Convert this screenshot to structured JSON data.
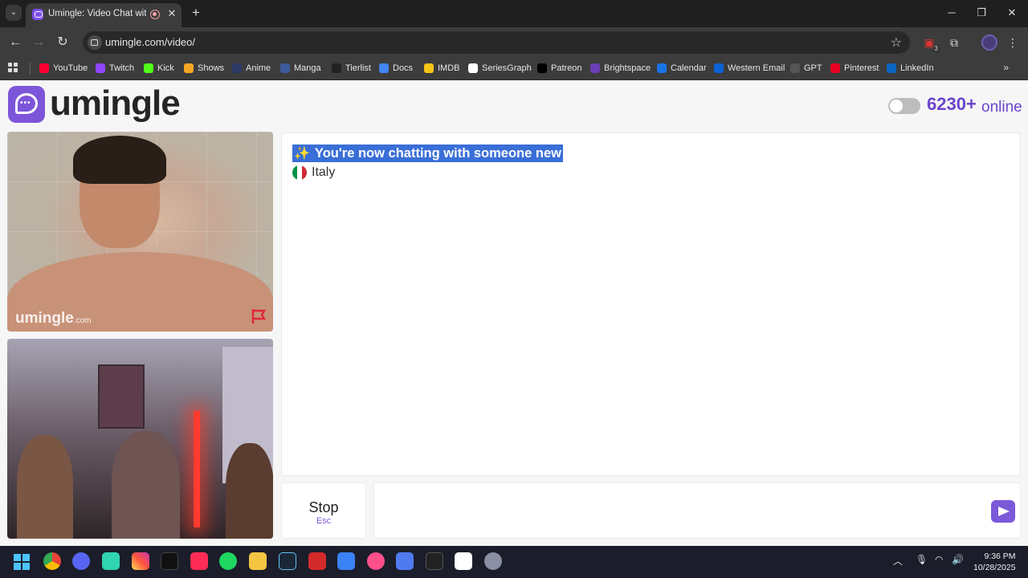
{
  "browser": {
    "tab_title": "Umingle: Video Chat with St",
    "url": "umingle.com/video/",
    "extension_badge": "3"
  },
  "bookmarks": [
    {
      "label": "YouTube",
      "icon": "youtube-icon",
      "color": "#ff0033"
    },
    {
      "label": "Twitch",
      "icon": "twitch-icon",
      "color": "#9146ff"
    },
    {
      "label": "Kick",
      "icon": "kick-icon",
      "color": "#53fc18"
    },
    {
      "label": "Shows",
      "icon": "shows-icon",
      "color": "#f5a623"
    },
    {
      "label": "Anime",
      "icon": "anime-icon",
      "color": "#2b3a67"
    },
    {
      "label": "Manga",
      "icon": "manga-icon",
      "color": "#3d5a99"
    },
    {
      "label": "Tierlist",
      "icon": "tierlist-icon",
      "color": "#222222"
    },
    {
      "label": "Docs",
      "icon": "docs-icon",
      "color": "#4285f4"
    },
    {
      "label": "IMDB",
      "icon": "imdb-icon",
      "color": "#f5c518"
    },
    {
      "label": "SeriesGraph",
      "icon": "seriesgraph-icon",
      "color": "#ffffff"
    },
    {
      "label": "Patreon",
      "icon": "patreon-icon",
      "color": "#000000"
    },
    {
      "label": "Brightspace",
      "icon": "brightspace-icon",
      "color": "#6a3fb5"
    },
    {
      "label": "Calendar",
      "icon": "calendar-icon",
      "color": "#1a73e8"
    },
    {
      "label": "Western Email",
      "icon": "outlook-icon",
      "color": "#0a64d6"
    },
    {
      "label": "GPT",
      "icon": "gpt-icon",
      "color": "#555555"
    },
    {
      "label": "Pinterest",
      "icon": "pinterest-icon",
      "color": "#e60023"
    },
    {
      "label": "LinkedIn",
      "icon": "linkedin-icon",
      "color": "#0a66c2"
    }
  ],
  "site": {
    "logo_text": "umingle",
    "online_count": "6230+",
    "online_label": "online",
    "accent_color": "#7d55d9"
  },
  "video": {
    "watermark": "umingle",
    "watermark_suffix": ".com"
  },
  "chat": {
    "status_message": "You're now chatting with someone new",
    "country": "Italy"
  },
  "controls": {
    "stop_label": "Stop",
    "stop_hint": "Esc",
    "message_placeholder": ""
  },
  "taskbar": {
    "time": "9:36 PM",
    "date": "10/28/2025"
  }
}
